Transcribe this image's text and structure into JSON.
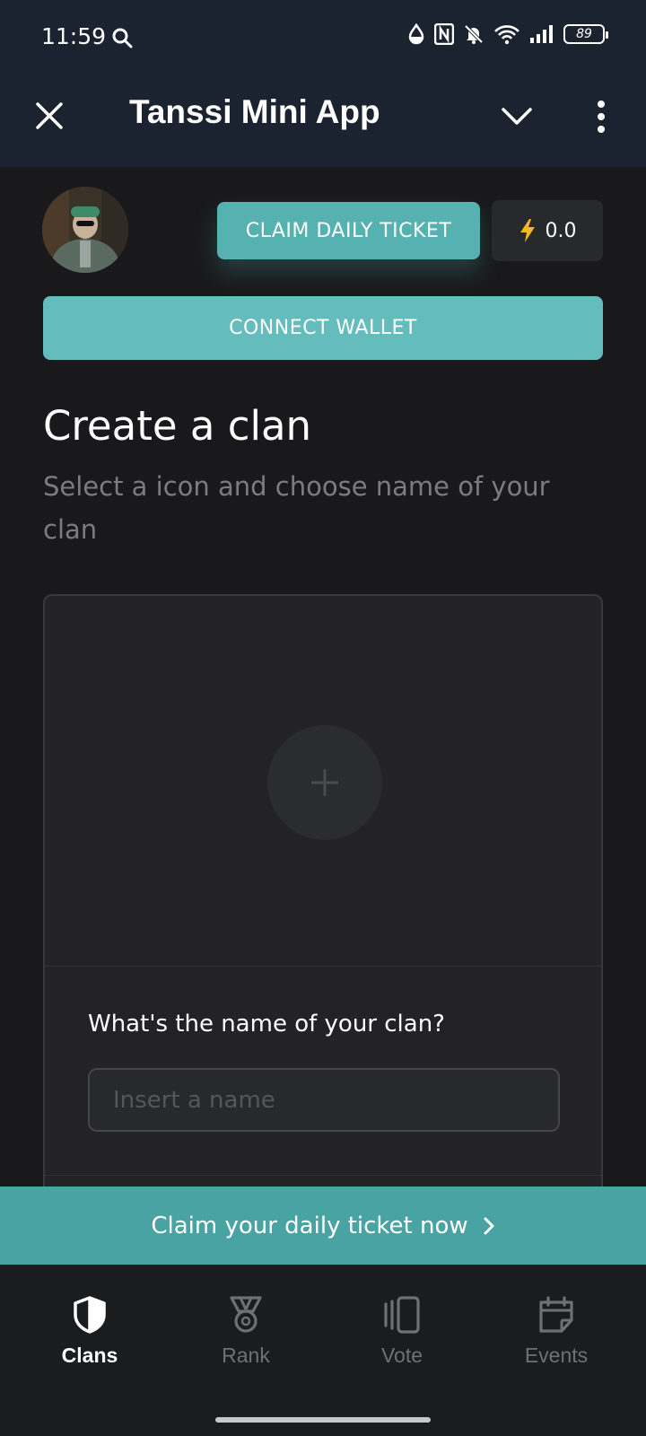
{
  "status_bar": {
    "time": "11:59",
    "battery": "89"
  },
  "header": {
    "title": "Tanssi Mini App"
  },
  "top_row": {
    "claim_button": "CLAIM DAILY TICKET",
    "energy_value": "0.0"
  },
  "connect_wallet": "CONNECT WALLET",
  "create_clan": {
    "title": "Create a clan",
    "subtitle": "Select a icon and choose name of your clan",
    "name_label": "What's the name of your clan?",
    "name_placeholder": "Insert a name",
    "name_value": ""
  },
  "banner": {
    "text": "Claim your daily ticket now"
  },
  "nav": {
    "items": [
      {
        "label": "Clans",
        "icon": "shield-icon",
        "active": true
      },
      {
        "label": "Rank",
        "icon": "medal-icon",
        "active": false
      },
      {
        "label": "Vote",
        "icon": "cards-icon",
        "active": false
      },
      {
        "label": "Events",
        "icon": "calendar-icon",
        "active": false
      }
    ]
  },
  "colors": {
    "accent": "#56b1b1",
    "banner": "#4aa3a3",
    "header_bg": "#1b2330",
    "bg": "#19191b",
    "energy_icon": "#f5b921"
  }
}
